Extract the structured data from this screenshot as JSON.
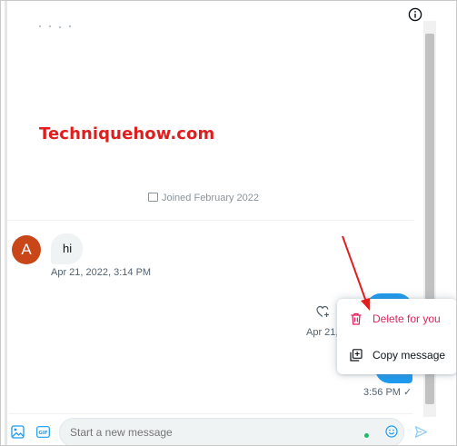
{
  "watermark": "Techniquehow.com",
  "joined_text": "Joined February 2022",
  "incoming": {
    "avatar_letter": "A",
    "message": "hi",
    "timestamp": "Apr 21, 2022, 3:14 PM"
  },
  "outgoing": {
    "partial_timestamp": "Apr 21,",
    "timestamp": "3:56 PM",
    "check": "✓"
  },
  "context_menu": {
    "delete_label": "Delete for you",
    "copy_label": "Copy message"
  },
  "composer": {
    "placeholder": "Start a new message"
  },
  "icons": {
    "info": "info-icon",
    "heart_add": "heart-add-icon",
    "trash": "trash-icon",
    "copy": "copy-icon",
    "media": "media-icon",
    "gif": "gif-icon",
    "emoji": "emoji-icon",
    "send": "send-icon"
  },
  "colors": {
    "accent": "#1d9bf0",
    "danger": "#e0245e",
    "avatar": "#c84618",
    "watermark": "#e01e1e",
    "arrow": "#e01e1e"
  }
}
